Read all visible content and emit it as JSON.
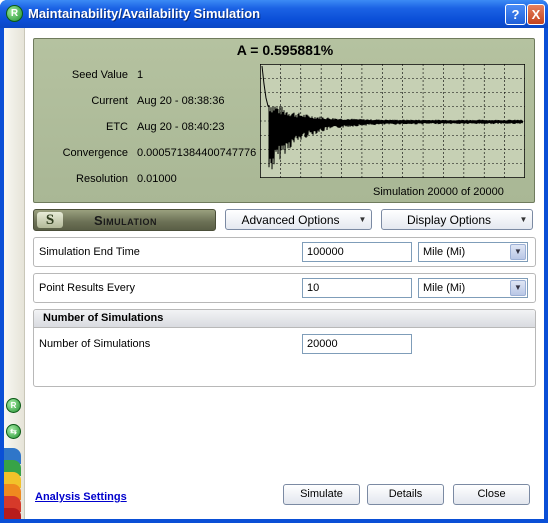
{
  "window": {
    "title": "Maintainability/Availability Simulation",
    "help_label": "?",
    "close_label": "X"
  },
  "display": {
    "heading": "A = 0.595881%",
    "stats": [
      {
        "label": "Seed Value",
        "value": "1"
      },
      {
        "label": "Current",
        "value": "Aug 20 - 08:38:36"
      },
      {
        "label": "ETC",
        "value": "Aug 20 - 08:40:23"
      },
      {
        "label": "Convergence",
        "value": "0.000571384400747776"
      },
      {
        "label": "Resolution",
        "value": "0.01000"
      }
    ],
    "progress": "Simulation 20000 of 20000"
  },
  "toolbar": {
    "section_letter": "S",
    "section_title": "Simulation",
    "advanced_options": "Advanced Options",
    "display_options": "Display Options"
  },
  "fields": {
    "end_time": {
      "label": "Simulation End Time",
      "value": "100000",
      "unit": "Mile (Mi)"
    },
    "point_results": {
      "label": "Point Results Every",
      "value": "10",
      "unit": "Mile (Mi)"
    },
    "num_sims_group": {
      "title": "Number of Simulations"
    },
    "num_sims": {
      "label": "Number of Simulations",
      "value": "20000"
    }
  },
  "footer": {
    "analysis_settings": "Analysis Settings",
    "simulate": "Simulate",
    "details": "Details",
    "close": "Close"
  },
  "icons": {
    "title": "reliasoft-r-icon",
    "side_top": "reliasoft-r-icon",
    "side_bottom": "arrows-icon"
  },
  "colors": {
    "titlebar": "#0b4fd8",
    "display_bg": "#aebb99",
    "plot_bg": "#c9d2b8",
    "link": "#0000cc"
  }
}
